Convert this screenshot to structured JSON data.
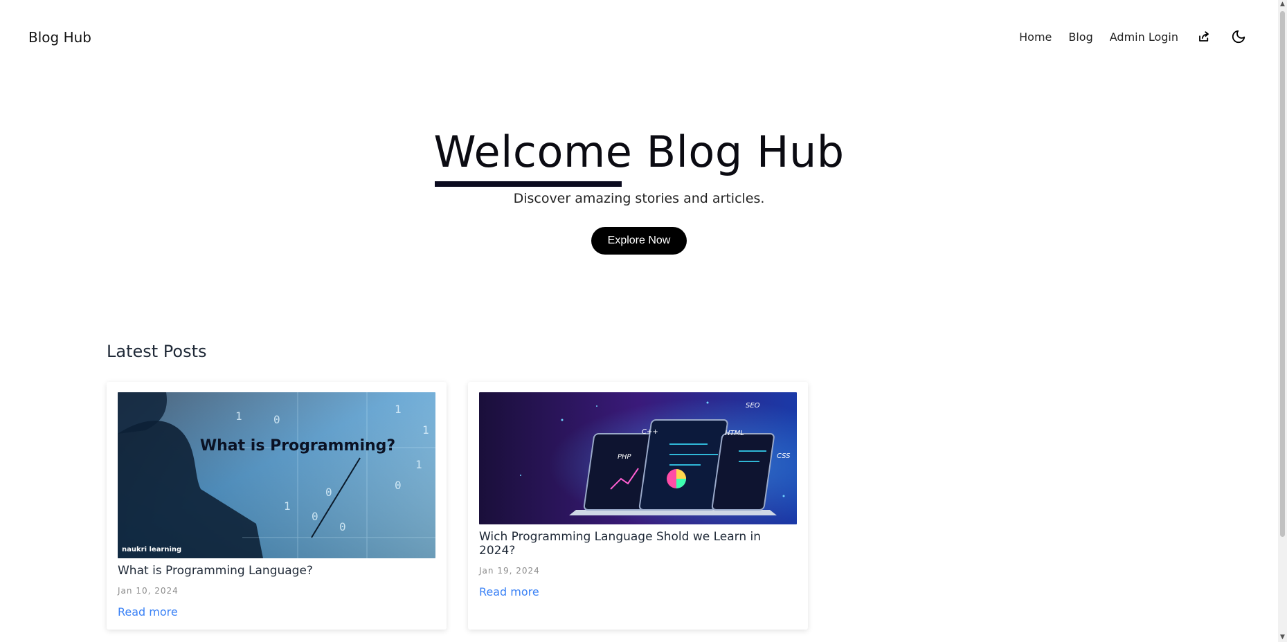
{
  "header": {
    "brand": "Blog Hub",
    "nav": {
      "home": "Home",
      "blog": "Blog",
      "admin": "Admin Login"
    },
    "icons": {
      "share": "share-icon",
      "theme": "moon-icon"
    }
  },
  "hero": {
    "title": "Welcome Blog Hub",
    "subtitle": "Discover amazing stories and articles.",
    "cta": "Explore Now"
  },
  "latest": {
    "heading": "Latest Posts",
    "posts": [
      {
        "title": "What is Programming Language?",
        "date": "Jan 10, 2024",
        "read_more": "Read more",
        "image_caption": "What is Programming?",
        "image_logo": "naukri learning"
      },
      {
        "title": "Wich Programming Language Shold we Learn in 2024?",
        "date": "Jan 19, 2024",
        "read_more": "Read more",
        "image_labels": [
          "SEO",
          "HTML",
          "PHP",
          "C++",
          "CSS"
        ]
      }
    ]
  },
  "colors": {
    "accent": "#3b82f6",
    "button_bg": "#000000",
    "underline": "#0b0b1f"
  }
}
